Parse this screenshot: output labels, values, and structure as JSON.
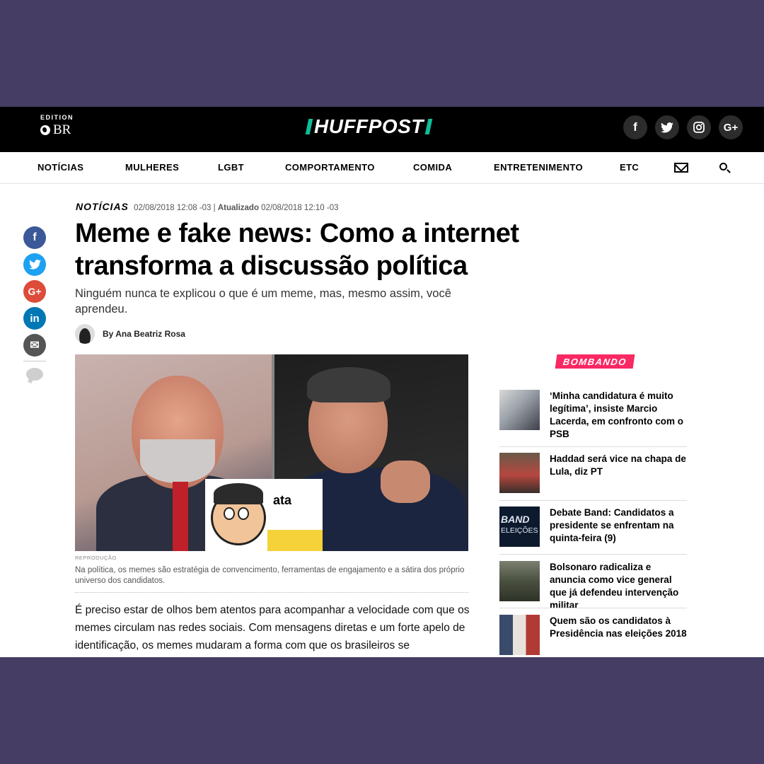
{
  "edition": {
    "label": "EDITION",
    "value": "BR"
  },
  "brand": {
    "name": "HUFFPOST",
    "accent": "#0dbe98"
  },
  "header_social": [
    {
      "icon": "facebook-icon",
      "glyph": "f"
    },
    {
      "icon": "twitter-icon",
      "glyph": "🐦"
    },
    {
      "icon": "instagram-icon",
      "glyph": "◎"
    },
    {
      "icon": "google-plus-icon",
      "glyph": "G+"
    }
  ],
  "nav": [
    "NOTÍCIAS",
    "MULHERES",
    "LGBT",
    "COMPORTAMENTO",
    "COMIDA",
    "ENTRETENIMENTO",
    "ETC"
  ],
  "share": [
    {
      "icon": "facebook-icon",
      "glyph": "f",
      "color": "#3b5998"
    },
    {
      "icon": "twitter-icon",
      "glyph": "🐦",
      "color": "#1da1f2"
    },
    {
      "icon": "google-plus-icon",
      "glyph": "G+",
      "color": "#dd4b39"
    },
    {
      "icon": "linkedin-icon",
      "glyph": "in",
      "color": "#0077b5"
    },
    {
      "icon": "email-icon",
      "glyph": "✉",
      "color": "#555555"
    }
  ],
  "article": {
    "section": "NOTÍCIAS",
    "published": "02/08/2018 12:08 -03 |",
    "updated_label": "Atualizado",
    "updated": "02/08/2018 12:10 -03",
    "headline": "Meme e fake news: Como a internet transforma a discussão política",
    "subhead": "Ninguém nunca te explicou o que é um meme, mas, mesmo assim, você aprendeu.",
    "author": "By Ana Beatriz Rosa",
    "image_credit": "REPRODUÇÃO",
    "meme_text": "ata",
    "caption": "Na política, os memes são estratégia de convencimento, ferramentas de engajamento e a sátira dos próprio universo dos candidatos.",
    "body": "É preciso estar de olhos bem atentos para acompanhar a velocidade com que os memes circulam nas redes sociais. Com mensagens diretas e um forte apelo de identificação, os memes mudaram a forma com que os brasileiros se"
  },
  "sidebar": {
    "badge": "BOMBANDO",
    "badge_color": "#fa2863",
    "items": [
      {
        "title": "‘Minha candidatura é muito legítima’, insiste Marcio Lacerda, em confronto com o PSB"
      },
      {
        "title": "Haddad será vice na chapa de Lula, diz PT"
      },
      {
        "title": "Debate Band: Candidatos a presidente se enfrentam na quinta-feira (9)",
        "thumb_text_1": "BAND",
        "thumb_text_2": "ELEIÇÕES"
      },
      {
        "title": "Bolsonaro radicaliza e anuncia como vice general que já defendeu intervenção militar"
      },
      {
        "title": "Quem são os candidatos à Presidência nas eleições 2018"
      }
    ]
  }
}
